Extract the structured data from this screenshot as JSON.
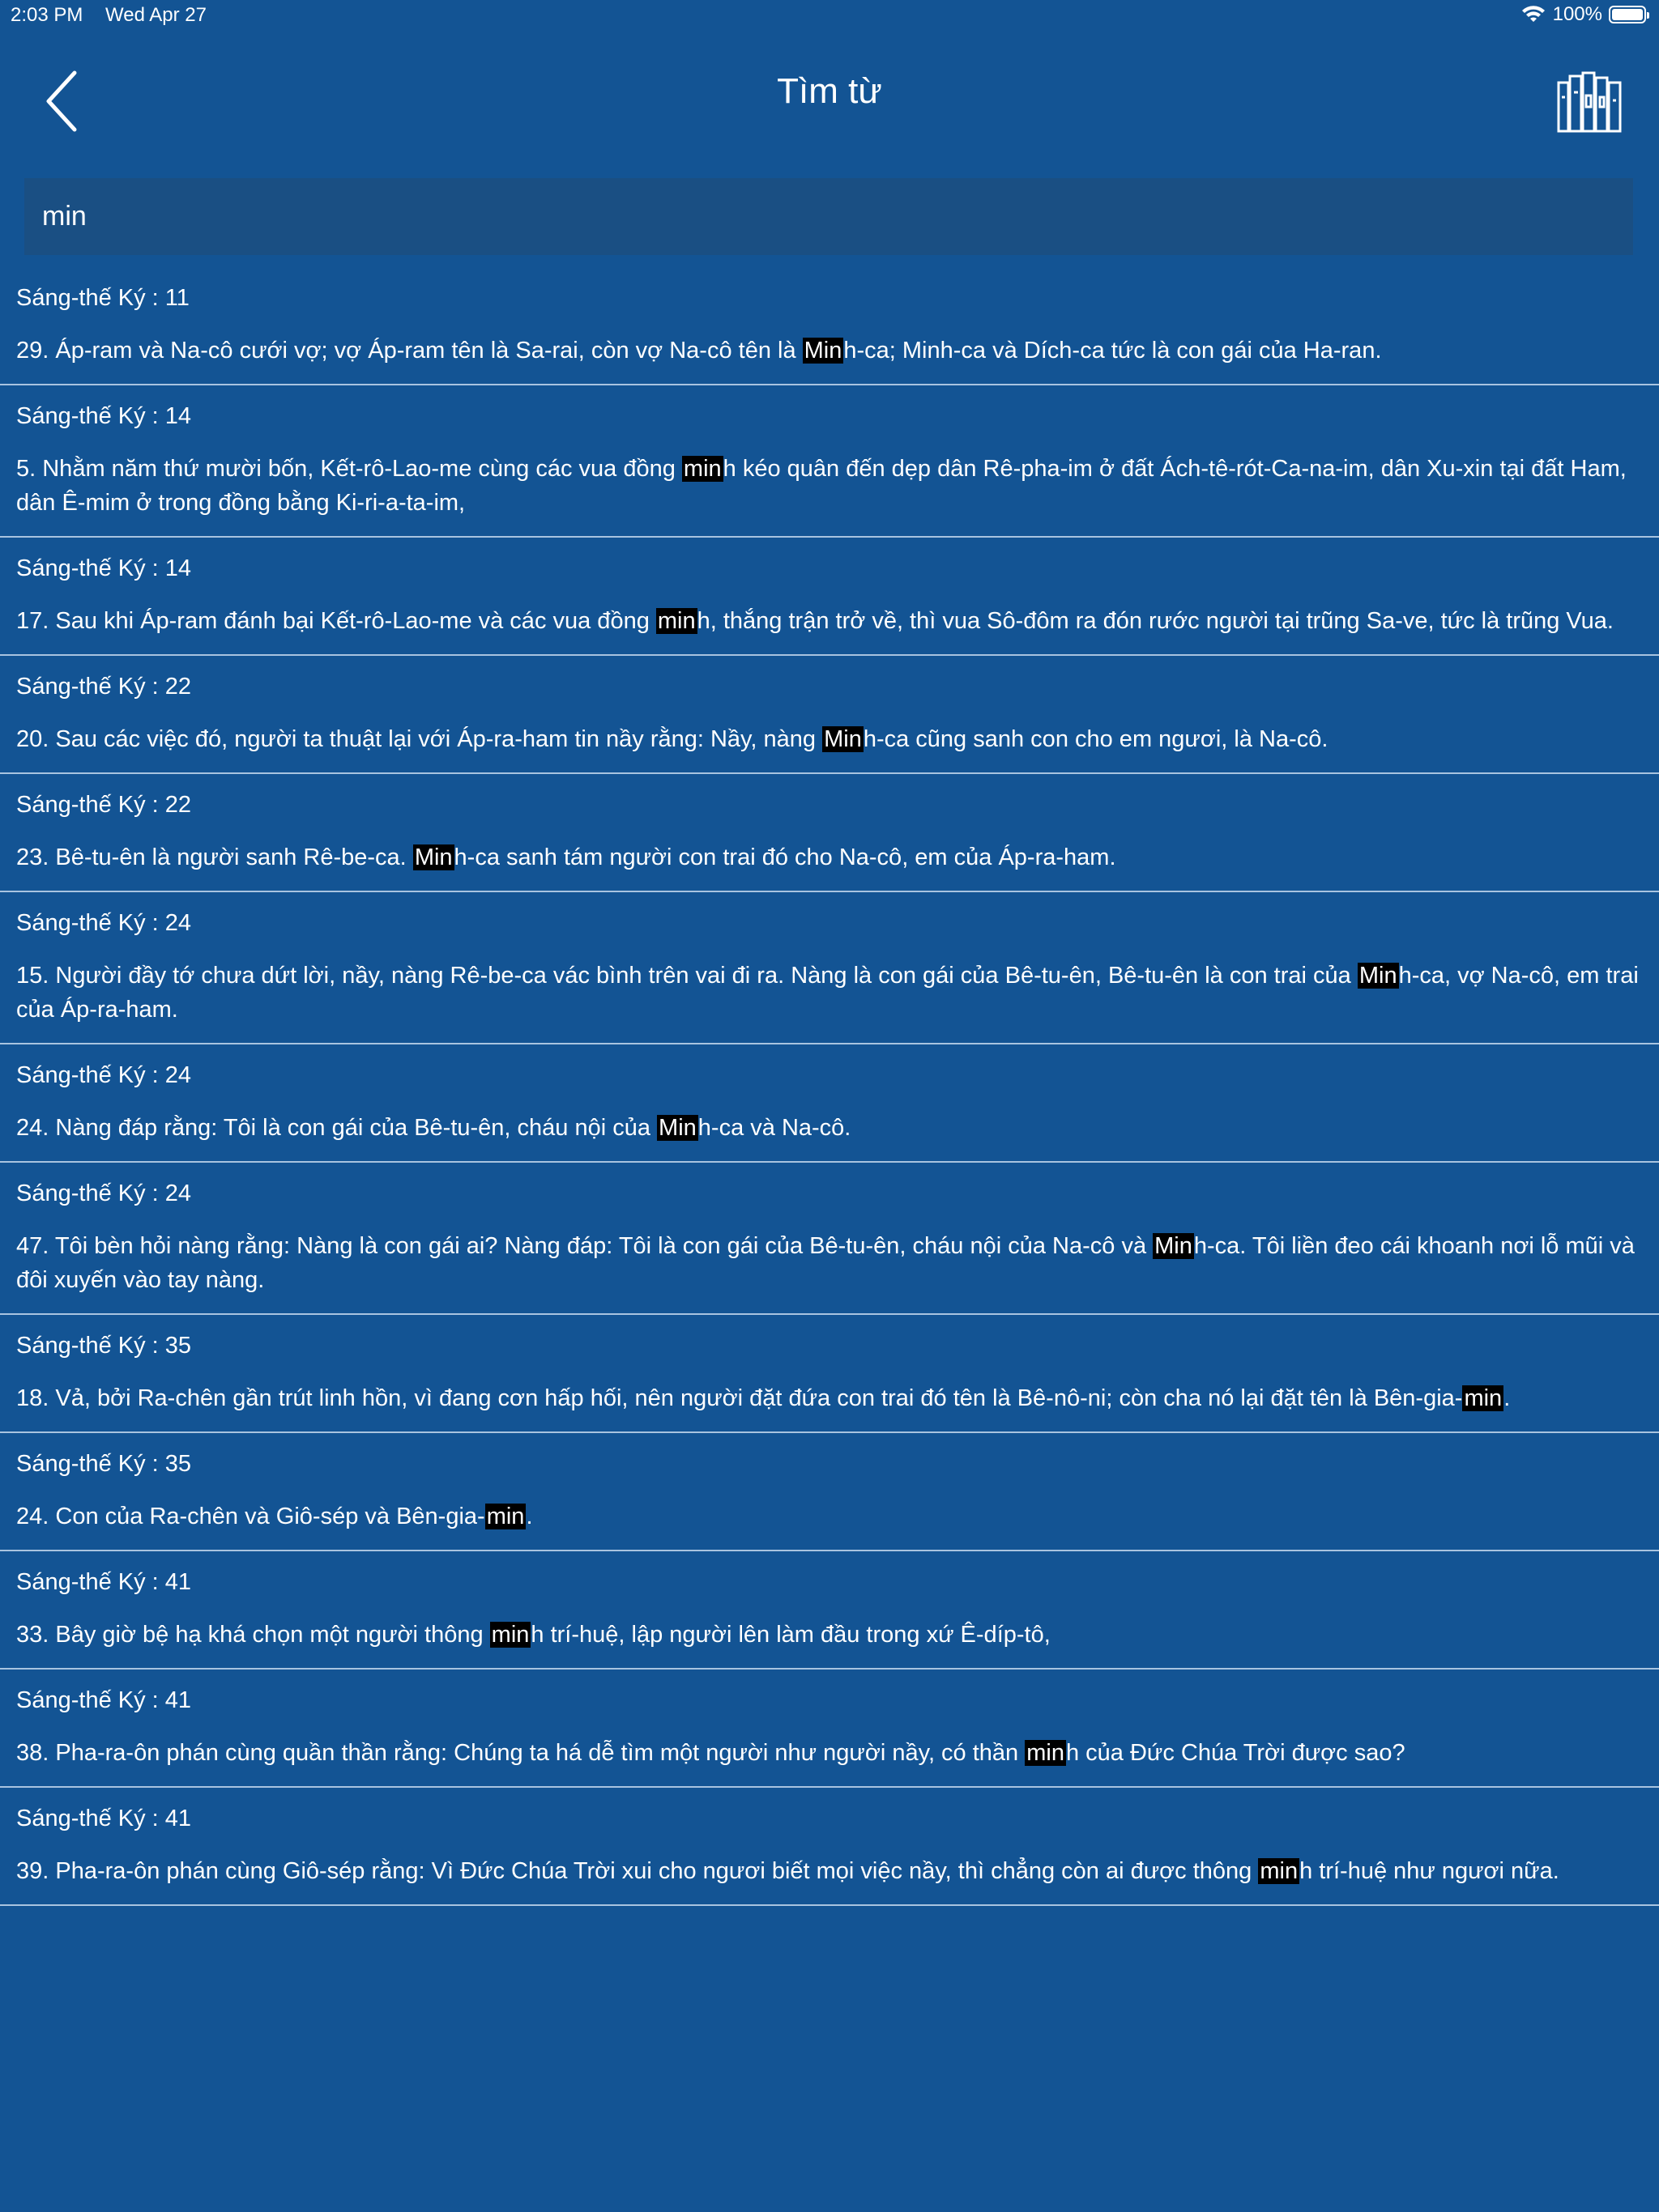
{
  "status": {
    "time": "2:03 PM",
    "date": "Wed Apr 27",
    "battery": "100%"
  },
  "nav": {
    "title": "Tìm từ",
    "back_icon": "chevron-left-icon",
    "library_icon": "books-icon"
  },
  "search": {
    "value": "min"
  },
  "results": [
    {
      "ref": "Sáng-thế Ký : 11",
      "before": "29. Áp-ram và Na-cô cưới vợ; vợ Áp-ram tên là Sa-rai, còn vợ Na-cô tên là ",
      "match": "Min",
      "after": "h-ca; Minh-ca và Dích-ca tức là con gái của Ha-ran."
    },
    {
      "ref": "Sáng-thế Ký : 14",
      "before": "5. Nhằm năm thứ mười bốn, Kết-rô-Lao-me cùng các vua đồng ",
      "match": "min",
      "after": "h kéo quân đến dẹp dân Rê-pha-im ở đất Ách-tê-rót-Ca-na-im, dân Xu-xin tại đất Ham, dân Ê-mim ở trong đồng bằng Ki-ri-a-ta-im,"
    },
    {
      "ref": "Sáng-thế Ký : 14",
      "before": "17. Sau khi Áp-ram đánh bại Kết-rô-Lao-me và các vua đồng ",
      "match": "min",
      "after": "h, thắng trận trở về, thì vua Sô-đôm ra đón rước người tại trũng Sa-ve, tức là trũng Vua."
    },
    {
      "ref": "Sáng-thế Ký : 22",
      "before": "20. Sau các việc đó, người ta thuật lại với Áp-ra-ham tin nầy rằng: Nầy, nàng ",
      "match": "Min",
      "after": "h-ca cũng sanh con cho em ngươi, là Na-cô."
    },
    {
      "ref": "Sáng-thế Ký : 22",
      "before": "23. Bê-tu-ên là người sanh Rê-be-ca. ",
      "match": "Min",
      "after": "h-ca sanh tám người con trai đó cho Na-cô, em của Áp-ra-ham."
    },
    {
      "ref": "Sáng-thế Ký : 24",
      "before": "15. Người đầy tớ chưa dứt lời, nầy, nàng Rê-be-ca vác bình trên vai đi ra. Nàng là con gái của Bê-tu-ên, Bê-tu-ên là con trai của ",
      "match": "Min",
      "after": "h-ca, vợ Na-cô, em trai của Áp-ra-ham."
    },
    {
      "ref": "Sáng-thế Ký : 24",
      "before": "24. Nàng đáp rằng: Tôi là con gái của Bê-tu-ên, cháu nội của ",
      "match": "Min",
      "after": "h-ca và Na-cô."
    },
    {
      "ref": "Sáng-thế Ký : 24",
      "before": "47. Tôi bèn hỏi nàng rằng: Nàng là con gái ai? Nàng đáp: Tôi là con gái của Bê-tu-ên, cháu nội của Na-cô và ",
      "match": "Min",
      "after": "h-ca. Tôi liền đeo cái khoanh nơi lỗ mũi và đôi xuyến vào tay nàng."
    },
    {
      "ref": "Sáng-thế Ký : 35",
      "before": "18. Vả, bởi Ra-chên gần trút linh hồn, vì đang cơn hấp hối, nên người đặt đứa con trai đó tên là Bê-nô-ni; còn cha nó lại đặt tên là Bên-gia-",
      "match": "min",
      "after": "."
    },
    {
      "ref": "Sáng-thế Ký : 35",
      "before": "24. Con của Ra-chên và Giô-sép và Bên-gia-",
      "match": "min",
      "after": "."
    },
    {
      "ref": "Sáng-thế Ký : 41",
      "before": "33. Bây giờ bệ hạ khá chọn một người thông ",
      "match": "min",
      "after": "h trí-huệ, lập người lên làm đầu trong xứ Ê-díp-tô,"
    },
    {
      "ref": "Sáng-thế Ký : 41",
      "before": "38. Pha-ra-ôn phán cùng quần thần rằng: Chúng ta há dễ tìm một người như người nầy, có thần ",
      "match": "min",
      "after": "h của Đức Chúa Trời được sao?"
    },
    {
      "ref": "Sáng-thế Ký : 41",
      "before": "39. Pha-ra-ôn phán cùng Giô-sép rằng: Vì Đức Chúa Trời xui cho ngươi biết mọi việc nầy, thì chẳng còn ai được thông ",
      "match": "min",
      "after": "h trí-huệ như ngươi nữa."
    }
  ]
}
